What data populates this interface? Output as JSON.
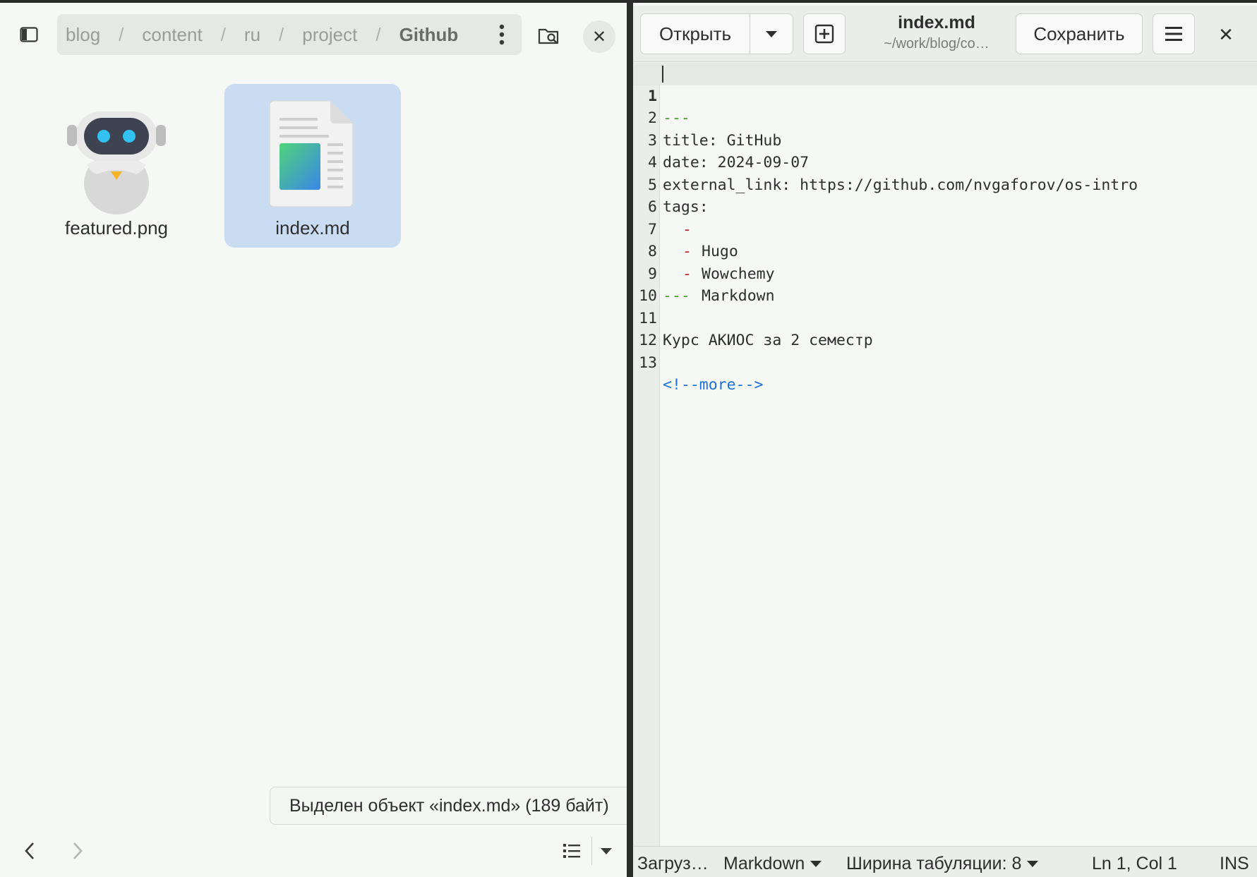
{
  "file_manager": {
    "breadcrumb": [
      "blog",
      "content",
      "ru",
      "project",
      "Github"
    ],
    "files": [
      {
        "name": "featured.png",
        "icon": "robot-image-icon",
        "selected": false
      },
      {
        "name": "index.md",
        "icon": "markdown-document-icon",
        "selected": true
      }
    ],
    "status": "Выделен объект «index.md» (189 байт)"
  },
  "editor": {
    "open_label": "Открыть",
    "save_label": "Сохранить",
    "title": "index.md",
    "subtitle": "~/work/blog/co…",
    "lines": [
      {
        "n": "1",
        "text": "---"
      },
      {
        "n": "2",
        "text": "title: GitHub"
      },
      {
        "n": "3",
        "text": "date: 2024-09-07"
      },
      {
        "n": "4",
        "text": "external_link: https://github.com/nvgaforov/os-intro"
      },
      {
        "n": "5",
        "text": "tags:"
      },
      {
        "n": "6",
        "bullet": "-",
        "text": "Hugo"
      },
      {
        "n": "7",
        "bullet": "-",
        "text": "Wowchemy"
      },
      {
        "n": "8",
        "bullet": "-",
        "text": "Markdown"
      },
      {
        "n": "9",
        "text": "---"
      },
      {
        "n": "10",
        "text": ""
      },
      {
        "n": "11",
        "text": "Курс АКИОС за 2 семестр"
      },
      {
        "n": "12",
        "text": ""
      },
      {
        "n": "13",
        "text": "<!--more-->"
      }
    ],
    "status": {
      "loading": "Загруз…",
      "language": "Markdown",
      "tab_width": "Ширина табуляции: 8",
      "position": "Ln 1, Col 1",
      "mode": "INS"
    }
  },
  "colors": {
    "selection": "#c9dcf2",
    "frontmatter_dash": "#4aa02c",
    "list_bullet": "#c01c28",
    "comment": "#1c71d8"
  }
}
